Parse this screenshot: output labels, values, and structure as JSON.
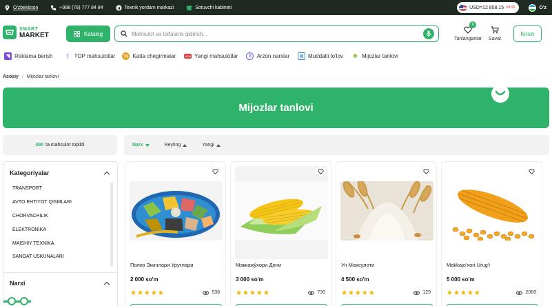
{
  "topbar": {
    "location": "O'zbekiston",
    "phone": "+998 (78) 777 84 84",
    "support": "Texnik yordam markazi",
    "seller": "Sotuvchi kabineti",
    "currency": "USD",
    "rate": "12 858.15",
    "rate_delta": "-58.95",
    "language": "O'z"
  },
  "header": {
    "logo_top": "SMART",
    "logo_bottom": "MARKET",
    "katalog": "Katalog",
    "search_placeholder": "Mahsulot va toifalarni qidirish...",
    "favorites_label": "Tanlanganlar",
    "favorites_count": "9",
    "cart_label": "Savat",
    "login": "Kirish"
  },
  "nav": [
    {
      "label": "Reklama berish",
      "icon": "megaphone-icon",
      "color": "#7a4ad8"
    },
    {
      "label": "TOP mahsulotlar",
      "icon": "top-arrow-icon",
      "color": "#6b6bd6"
    },
    {
      "label": "Katta chegirmalar",
      "icon": "discount-icon",
      "color": "#e0a020"
    },
    {
      "label": "Yangi mahsulotlar",
      "icon": "new-badge-icon",
      "color": "#e03a3a"
    },
    {
      "label": "Arzon narxlar",
      "icon": "cheap-icon",
      "color": "#6b6bd6"
    },
    {
      "label": "Muddatli to'lov",
      "icon": "calendar-icon",
      "color": "#3a8ad8"
    },
    {
      "label": "Mijozlar tanlovi",
      "icon": "choice-icon",
      "color": "#8ac040"
    }
  ],
  "breadcrumb": {
    "home": "Asosiy",
    "current": "Mijozlar tanlovi"
  },
  "banner": {
    "title": "Mijozlar tanlovi"
  },
  "results": {
    "count": "490",
    "text": "ta mahsulot topildi"
  },
  "sort": {
    "price": "Narx",
    "rating": "Reyting",
    "new": "Yangi"
  },
  "sidebar": {
    "categories_title": "Kategoriyalar",
    "categories": [
      "TRANSPORT",
      "AVTO EHTIYOT QISMLARI",
      "CHORVACHILIK",
      "ELEKTRONIKA",
      "MAISHIY TEXNIKA",
      "SANOAT USKUNALARI"
    ],
    "price_title": "Narxi"
  },
  "products": [
    {
      "name": "Полиз Экинлари Уруғлари",
      "price": "2 000 so'm",
      "stars": "★★★★★",
      "views": "538"
    },
    {
      "name": "Маккажўхори Дони",
      "price": "3 000 so'm",
      "stars": "★★★★★",
      "views": "730"
    },
    {
      "name": "Ун Махсулоти",
      "price": "4 500 so'm",
      "stars": "★★★★★",
      "views": "129"
    },
    {
      "name": "Makkajo'xori Urug'i",
      "price": "5 000 so'm",
      "stars": "★★★★★",
      "views": "2069"
    }
  ]
}
